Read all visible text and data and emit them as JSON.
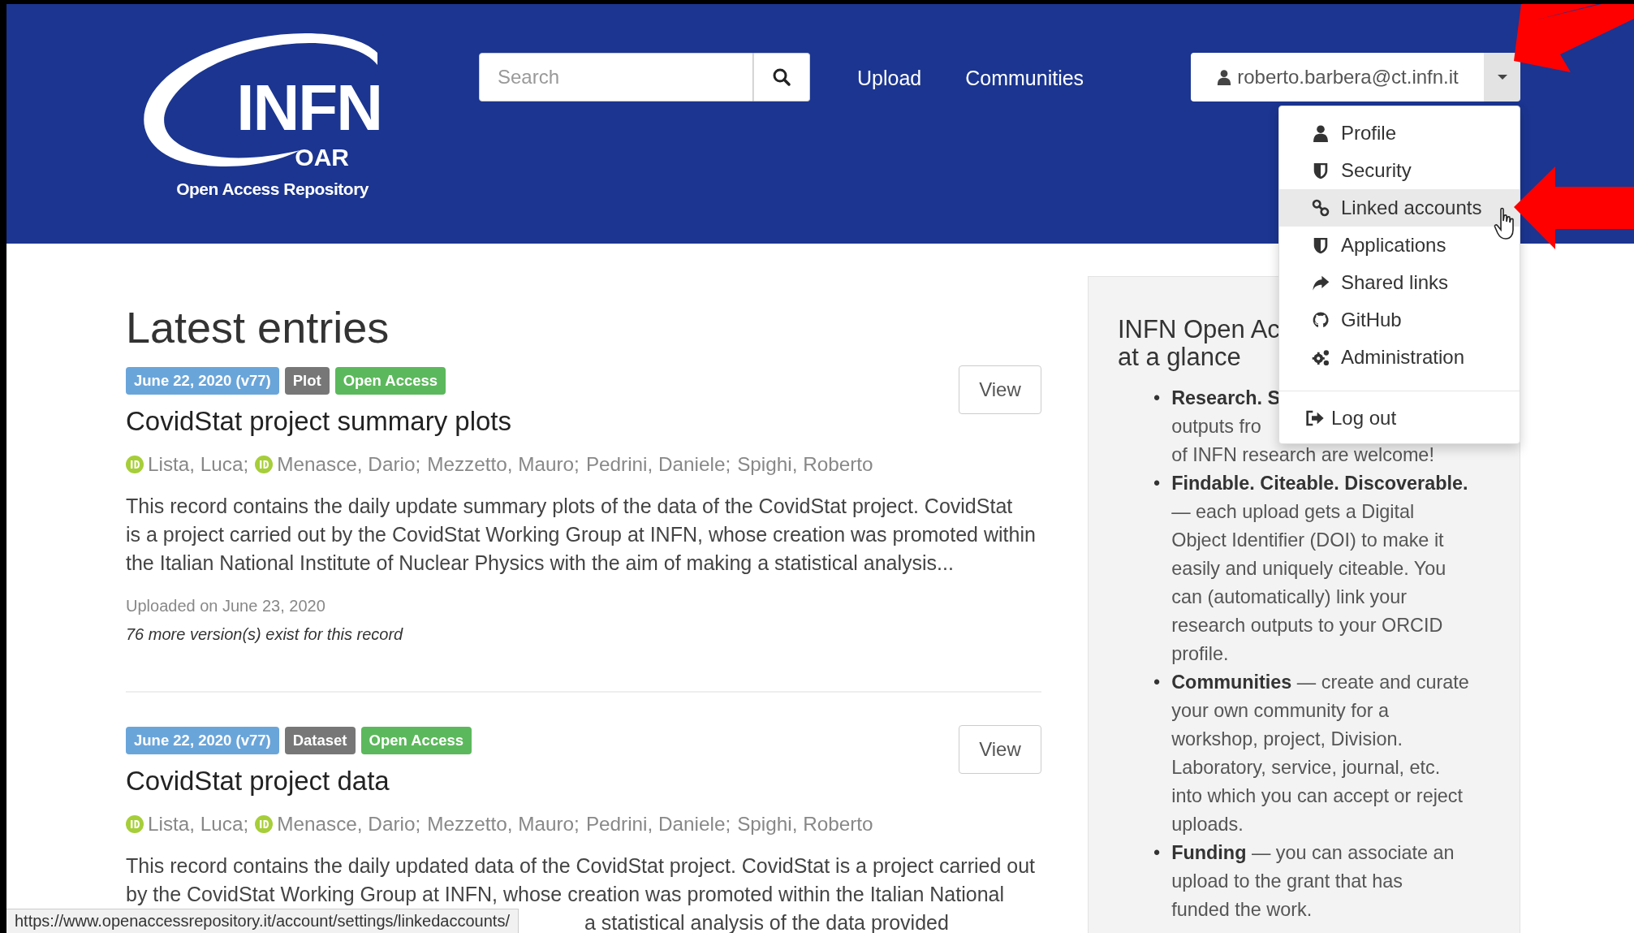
{
  "logo": {
    "name": "INFN",
    "sub": "OAR",
    "tagline": "Open Access Repository"
  },
  "search": {
    "placeholder": "Search"
  },
  "nav": [
    "Upload",
    "Communities"
  ],
  "user": {
    "email": "roberto.barbera@ct.infn.it"
  },
  "user_menu": {
    "items": [
      {
        "label": "Profile",
        "selected": false
      },
      {
        "label": "Security",
        "selected": false
      },
      {
        "label": "Linked accounts",
        "selected": true
      },
      {
        "label": "Applications",
        "selected": false
      },
      {
        "label": "Shared links",
        "selected": false
      },
      {
        "label": "GitHub",
        "selected": false
      },
      {
        "label": "Administration",
        "selected": false
      }
    ],
    "logout": "Log out"
  },
  "heading": "Latest entries",
  "entries": [
    {
      "badges": [
        {
          "label": "June 22, 2020 (v77)",
          "kind": "date"
        },
        {
          "label": "Plot",
          "kind": "type"
        },
        {
          "label": "Open Access",
          "kind": "access"
        }
      ],
      "view": "View",
      "title": "CovidStat project summary plots",
      "authors": [
        {
          "name": "Lista, Luca;",
          "id_icon": true
        },
        {
          "name": "Menasce, Dario;",
          "id_icon": true
        },
        {
          "name": "Mezzetto, Mauro;",
          "id_icon": false
        },
        {
          "name": "Pedrini, Daniele;",
          "id_icon": false
        },
        {
          "name": "Spighi, Roberto",
          "id_icon": false
        }
      ],
      "description": [
        {
          "text": "This record contains the daily update summary plots of the data of the CovidStat project. CovidStat",
          "covered": false
        },
        {
          "text": "is a project carried out by the CovidStat Working Group at INFN, whose creation was promoted within",
          "covered": false
        },
        {
          "text": "the Italian National Institute of Nuclear Physics with the aim of making a statistical analysis...",
          "covered": false
        }
      ],
      "uploaded": "Uploaded on June 23, 2020",
      "versions": "76 more version(s) exist for this record"
    },
    {
      "badges": [
        {
          "label": "June 22, 2020 (v77)",
          "kind": "date"
        },
        {
          "label": "Dataset",
          "kind": "type"
        },
        {
          "label": "Open Access",
          "kind": "access"
        }
      ],
      "view": "View",
      "title": "CovidStat project data",
      "authors": [
        {
          "name": "Lista, Luca;",
          "id_icon": true
        },
        {
          "name": "Menasce, Dario;",
          "id_icon": true
        },
        {
          "name": "Mezzetto, Mauro;",
          "id_icon": false
        },
        {
          "name": "Pedrini, Daniele;",
          "id_icon": false
        },
        {
          "name": "Spighi, Roberto",
          "id_icon": false
        }
      ],
      "description": [
        {
          "text": "This record contains the daily updated data of the CovidStat project. CovidStat is a project carried out",
          "covered": false
        },
        {
          "text": "by the CovidStat Working Group at INFN, whose creation was promoted within the Italian National",
          "covered": false
        },
        {
          "text": "a statistical analysis of the data provided",
          "covered": true
        }
      ]
    }
  ],
  "sidebar": {
    "heading": [
      "INFN Open Ac",
      "at a glance"
    ],
    "bullets": [
      {
        "marker": "•",
        "lines": [
          "**Research. S**",
          "outputs fro",
          "of INFN research are welcome!"
        ]
      },
      {
        "marker": "•",
        "lines": [
          "**Findable. Citeable. Discoverable.**",
          "— each upload gets a Digital",
          "Object Identifier (DOI) to make it",
          "easily and uniquely citeable. You",
          "can (automatically) link your",
          "research outputs to your ORCID",
          "profile."
        ]
      },
      {
        "marker": "•",
        "lines": [
          "**Communities** — create and curate",
          "your own community for a",
          "workshop, project, Division.",
          "Laboratory, service, journal, etc.",
          "into which you can accept or reject",
          "uploads."
        ]
      },
      {
        "marker": "•",
        "lines": [
          "**Funding** — you can associate an",
          "upload to the grant that has",
          "funded the work."
        ]
      }
    ]
  },
  "status_bar": "https://www.openaccessrepository.it/account/settings/linkedaccounts/"
}
